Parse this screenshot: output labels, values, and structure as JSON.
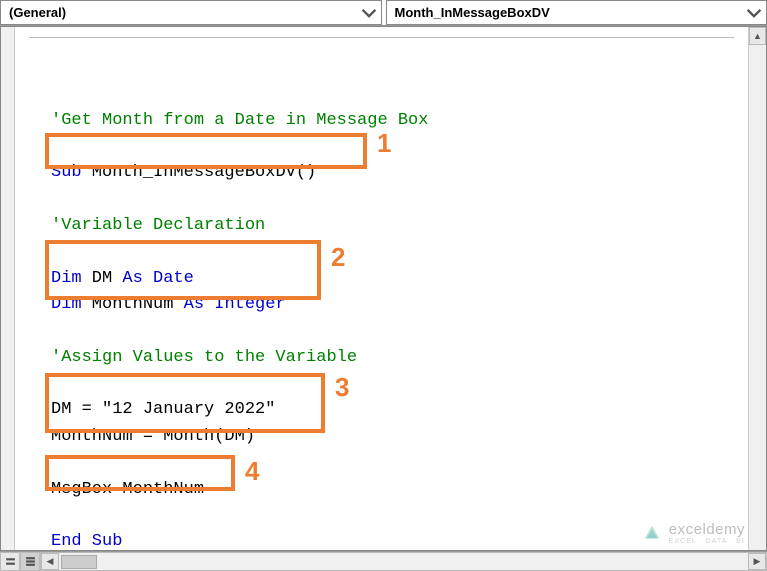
{
  "dropdowns": {
    "object": "(General)",
    "procedure": "Month_InMessageBoxDV"
  },
  "code": {
    "c1": "'Get Month from a Date in Message Box",
    "l2_sub": "Sub",
    "l2_name": " Month_InMessageBoxDV()",
    "c2": "'Variable Declaration",
    "l3_dim": "Dim",
    "l3_a": " DM ",
    "l3_as": "As",
    "l3_b": " ",
    "l3_date": "Date",
    "l4_dim": "Dim",
    "l4_a": " MonthNum ",
    "l4_as": "As",
    "l4_b": " ",
    "l4_int": "Integer",
    "c3": "'Assign Values to the Variable",
    "l5": "DM = \"12 January 2022\"",
    "l6": "MonthNum = Month(DM)",
    "l7": "MsgBox MonthNum",
    "l8": "End Sub"
  },
  "callouts": {
    "n1": "1",
    "n2": "2",
    "n3": "3",
    "n4": "4"
  },
  "watermark": {
    "brand": "exceldemy",
    "tag": "EXCEL · DATA · BI"
  }
}
